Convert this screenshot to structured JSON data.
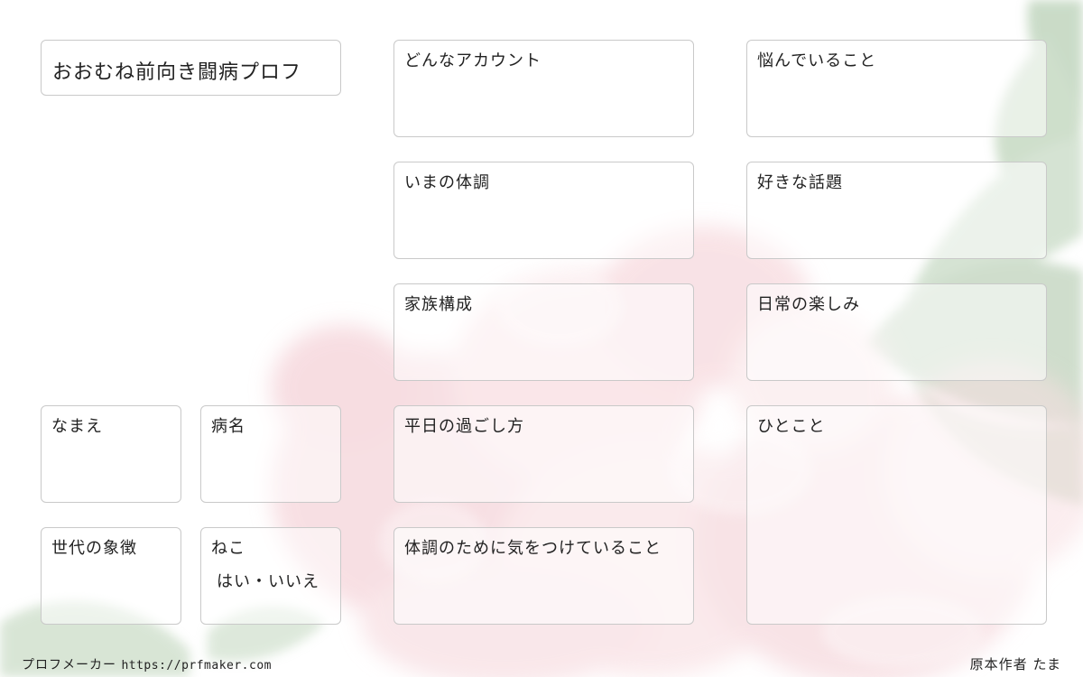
{
  "title": "おおむね前向き闘病プロフ",
  "cards": {
    "account": "どんなアカウント",
    "worries": "悩んでいること",
    "condition": "いまの体調",
    "topics": "好きな話題",
    "family": "家族構成",
    "joys": "日常の楽しみ",
    "name": "なまえ",
    "disease": "病名",
    "weekday": "平日の過ごし方",
    "comment": "ひとこと",
    "generation": "世代の象徴",
    "cat": "ねこ",
    "cat_options": "はい・いいえ",
    "health_care": "体調のために気をつけていること"
  },
  "footer": {
    "maker_label": "プロフメーカー",
    "maker_url": "https://prfmaker.com",
    "author": "原本作者 たま"
  },
  "colors": {
    "card_border": "#c9c9c9",
    "rose_pink": "#f2c9cf",
    "leaf_green": "#a9c3a4"
  }
}
